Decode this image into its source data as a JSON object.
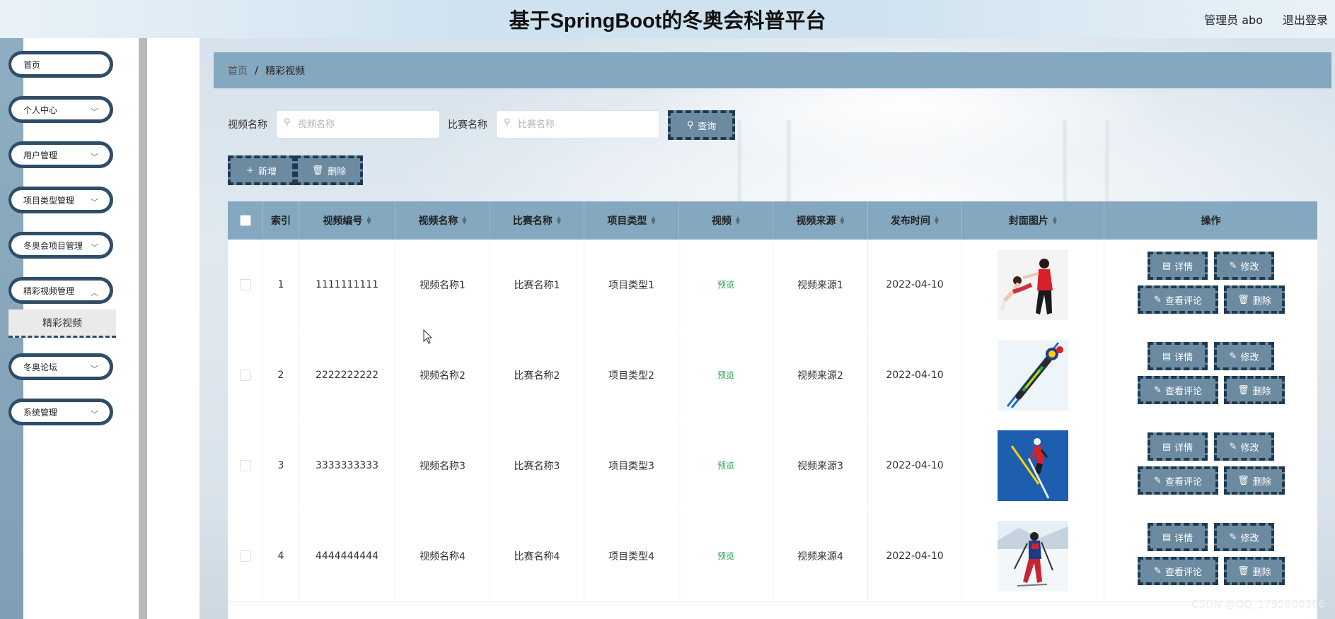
{
  "header": {
    "title": "基于SpringBoot的冬奥会科普平台",
    "admin_label": "管理员 abo",
    "logout_label": "退出登录"
  },
  "sidebar": {
    "items": [
      {
        "label": "首页",
        "has_arrow": false
      },
      {
        "label": "个人中心",
        "has_arrow": true
      },
      {
        "label": "用户管理",
        "has_arrow": true
      },
      {
        "label": "项目类型管理",
        "has_arrow": true
      },
      {
        "label": "冬奥会项目管理",
        "has_arrow": true
      },
      {
        "label": "精彩视频管理",
        "has_arrow": true
      },
      {
        "label": "冬奥论坛",
        "has_arrow": true
      },
      {
        "label": "系统管理",
        "has_arrow": true
      }
    ],
    "submenu_label": "精彩视频"
  },
  "breadcrumb": {
    "home": "首页",
    "separator": "/",
    "current": "精彩视频"
  },
  "search": {
    "video_name_label": "视频名称",
    "video_name_placeholder": "视频名称",
    "match_name_label": "比赛名称",
    "match_name_placeholder": "比赛名称",
    "query_label": "查询"
  },
  "actions": {
    "add_label": "新增",
    "delete_label": "删除"
  },
  "table": {
    "columns": [
      "索引",
      "视频编号",
      "视频名称",
      "比赛名称",
      "项目类型",
      "视频",
      "视频来源",
      "发布时间",
      "封面图片",
      "操作"
    ],
    "rows": [
      {
        "index": "1",
        "code": "1111111111",
        "name": "视频名称1",
        "match": "比赛名称1",
        "type": "项目类型1",
        "video": "预览",
        "source": "视频来源1",
        "date": "2022-04-10",
        "image": "figure-skating-pair"
      },
      {
        "index": "2",
        "code": "2222222222",
        "name": "视频名称2",
        "match": "比赛名称2",
        "type": "项目类型2",
        "video": "预览",
        "source": "视频来源2",
        "date": "2022-04-10",
        "image": "ski-jumper"
      },
      {
        "index": "3",
        "code": "3333333333",
        "name": "视频名称3",
        "match": "比赛名称3",
        "type": "项目类型3",
        "video": "预览",
        "source": "视频来源3",
        "date": "2022-04-10",
        "image": "ski-jumper-blue-sky"
      },
      {
        "index": "4",
        "code": "4444444444",
        "name": "视频名称4",
        "match": "比赛名称4",
        "type": "项目类型4",
        "video": "预览",
        "source": "视频来源4",
        "date": "2022-04-10",
        "image": "biathlon-skier"
      }
    ],
    "row_buttons": {
      "detail": "详情",
      "edit": "修改",
      "comments": "查看评论",
      "delete": "删除"
    }
  },
  "watermark": "CSDN @QQ_1795806396",
  "colors": {
    "accent": "#84a8bf",
    "button": "#6c8aa0",
    "button_border": "#1f3950",
    "sidebar_border": "#2e4d68",
    "preview": "#2aa45a"
  }
}
